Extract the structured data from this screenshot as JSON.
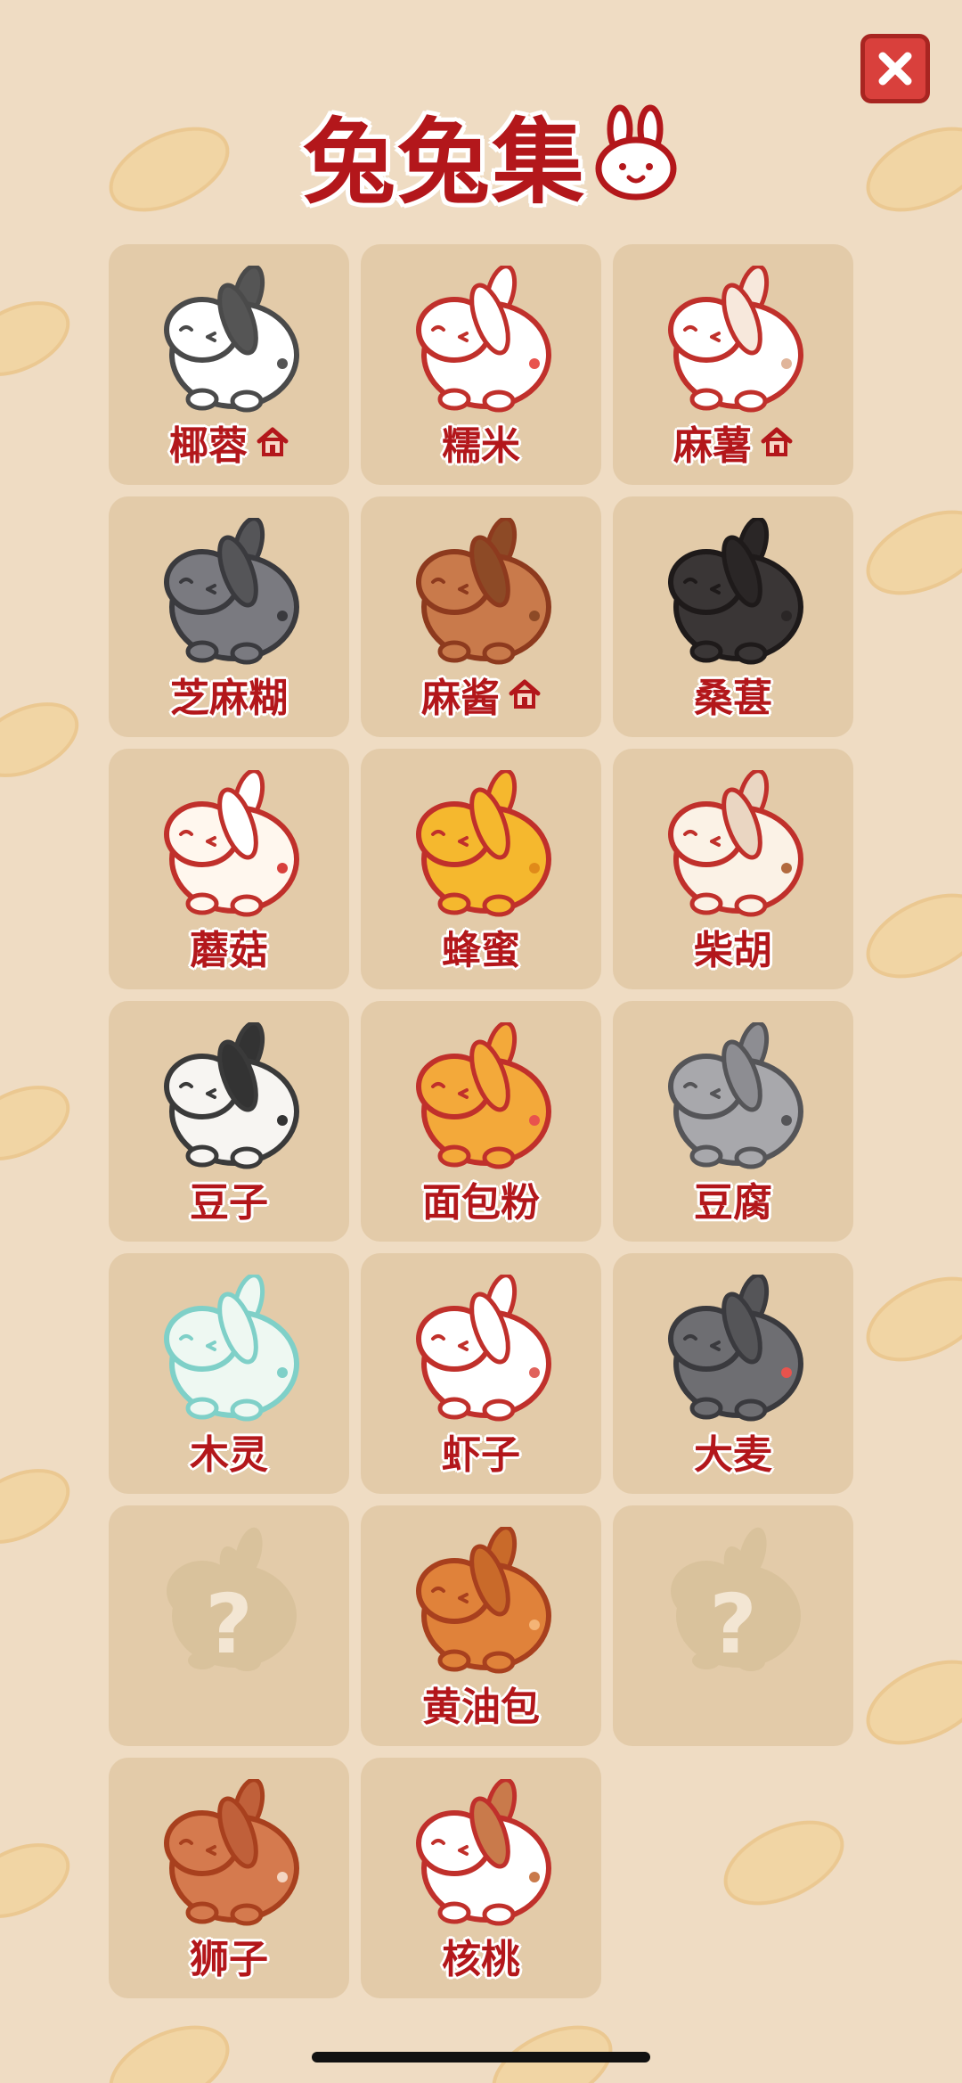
{
  "header": {
    "title": "兔兔集"
  },
  "bunnies": [
    {
      "name": "椰蓉",
      "home": true,
      "body": "#ffffff",
      "ear": "#555555",
      "accent": "#555555",
      "outline": "#4a4a4a"
    },
    {
      "name": "糯米",
      "home": false,
      "body": "#ffffff",
      "ear": "#ffffff",
      "accent": "#e8534d",
      "outline": "#c0302b"
    },
    {
      "name": "麻薯",
      "home": true,
      "body": "#ffffff",
      "ear": "#f7e8dc",
      "accent": "#e0b59a",
      "outline": "#c0302b"
    },
    {
      "name": "芝麻糊",
      "home": false,
      "body": "#7a7a80",
      "ear": "#555558",
      "accent": "#3a3a3e",
      "outline": "#3a3a3e"
    },
    {
      "name": "麻酱",
      "home": true,
      "body": "#c97a4b",
      "ear": "#8d4a26",
      "accent": "#8d4a26",
      "outline": "#8d3a1e"
    },
    {
      "name": "桑葚",
      "home": false,
      "body": "#3a3636",
      "ear": "#2a2626",
      "accent": "#2a2626",
      "outline": "#1e1a1a"
    },
    {
      "name": "蘑菇",
      "home": false,
      "body": "#fff7ee",
      "ear": "#ffffff",
      "accent": "#d8403c",
      "outline": "#c0302b"
    },
    {
      "name": "蜂蜜",
      "home": false,
      "body": "#f5b82e",
      "ear": "#f5b82e",
      "accent": "#e08a1a",
      "outline": "#c0302b"
    },
    {
      "name": "柴胡",
      "home": false,
      "body": "#fbf2e6",
      "ear": "#ead6c2",
      "accent": "#b26a3e",
      "outline": "#c0302b"
    },
    {
      "name": "豆子",
      "home": false,
      "body": "#f7f5f2",
      "ear": "#333333",
      "accent": "#333333",
      "outline": "#3a3a3a"
    },
    {
      "name": "面包粉",
      "home": false,
      "body": "#f3a93a",
      "ear": "#f3a93a",
      "accent": "#e8534d",
      "outline": "#c0302b"
    },
    {
      "name": "豆腐",
      "home": false,
      "body": "#a8a8ac",
      "ear": "#8d8d92",
      "accent": "#555558",
      "outline": "#555558"
    },
    {
      "name": "木灵",
      "home": false,
      "body": "#eef8f2",
      "ear": "#eef8f2",
      "accent": "#7fd0c8",
      "outline": "#7fd0c8"
    },
    {
      "name": "虾子",
      "home": false,
      "body": "#ffffff",
      "ear": "#ffffff",
      "accent": "#e0625c",
      "outline": "#c0302b"
    },
    {
      "name": "大麦",
      "home": false,
      "body": "#6e6e72",
      "ear": "#555558",
      "accent": "#e8534d",
      "outline": "#3a3a3e"
    },
    {
      "name": "",
      "locked": true
    },
    {
      "name": "黄油包",
      "home": false,
      "body": "#e0823a",
      "ear": "#c96a2a",
      "accent": "#f4b476",
      "outline": "#a8401e"
    },
    {
      "name": "",
      "locked": true
    },
    {
      "name": "狮子",
      "home": false,
      "body": "#d57a4e",
      "ear": "#c0603a",
      "accent": "#f4d6c2",
      "outline": "#a8401e"
    },
    {
      "name": "核桃",
      "home": false,
      "body": "#ffffff",
      "ear": "#c97a4b",
      "accent": "#c97a4b",
      "outline": "#c0302b"
    }
  ],
  "locked_symbol": "?",
  "colors": {
    "title": "#b3171b",
    "background": "#efdcc3",
    "card": "#d8be94"
  }
}
